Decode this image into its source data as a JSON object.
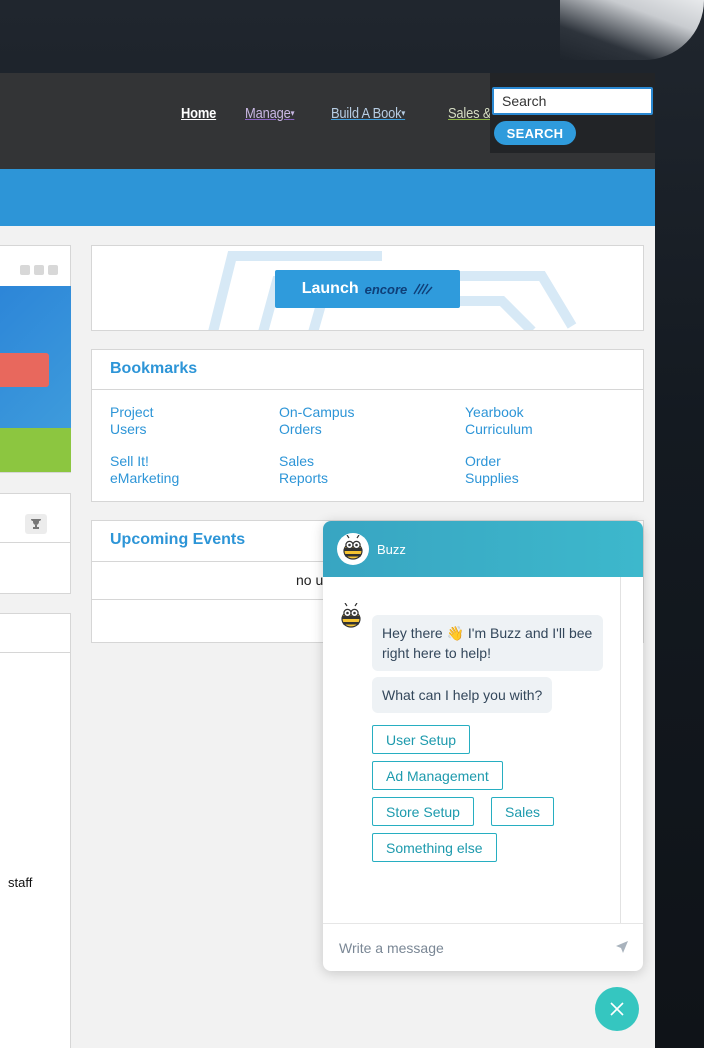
{
  "nav": {
    "home": "Home",
    "manage": "Manage",
    "build": "Build A Book",
    "sales": "Sales &",
    "caret": "▾"
  },
  "search": {
    "placeholder": "Search",
    "button": "SEARCH"
  },
  "launch": {
    "label": "Launch",
    "logo": "encore"
  },
  "bookmarks": {
    "title": "Bookmarks",
    "links": [
      "Project Users",
      "On-Campus Orders",
      "Yearbook Curriculum",
      "Sell It! eMarketing",
      "Sales Reports",
      "Order Supplies"
    ]
  },
  "events": {
    "title": "Upcoming Events",
    "empty": "no u"
  },
  "left": {
    "staff": "staff"
  },
  "chat": {
    "name": "Buzz",
    "greeting": "Hey there 👋 I'm Buzz and I'll bee right here to help!",
    "question": "What can I help you with?",
    "options": [
      "User Setup",
      "Ad Management",
      "Store Setup",
      "Sales",
      "Something else"
    ],
    "input_placeholder": "Write a message"
  },
  "icons": {
    "search": "search-icon",
    "trophy": "trophy-icon",
    "send": "send-icon",
    "close": "close-icon",
    "bee": "bee-avatar-icon"
  },
  "colors": {
    "accent": "#2d95d7",
    "chat_teal": "#3db8cc",
    "fab": "#35c6c0",
    "nav_bg": "#333436"
  }
}
